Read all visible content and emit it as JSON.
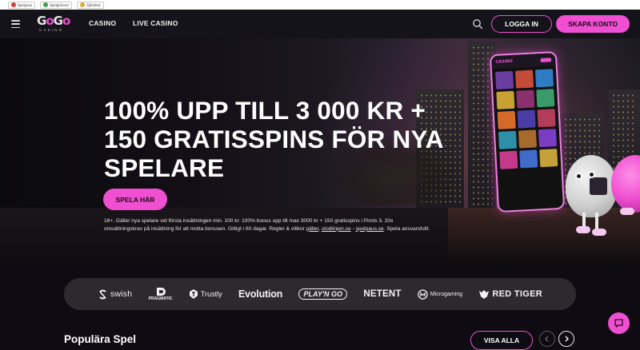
{
  "regulatory": {
    "items": [
      {
        "label": "Spelpaus",
        "color": "#d93a3a"
      },
      {
        "label": "Spelgränser",
        "color": "#3aa34b"
      },
      {
        "label": "Självtest",
        "color": "#e0a93a"
      }
    ]
  },
  "header": {
    "logo_main": [
      "G",
      "o",
      "G",
      "o"
    ],
    "logo_sub": "CASINO",
    "nav": [
      {
        "label": "CASINO"
      },
      {
        "label": "LIVE CASINO"
      }
    ],
    "login_label": "LOGGA IN",
    "signup_label": "SKAPA KONTO",
    "icons": {
      "menu": "hamburger-icon",
      "search": "search-icon"
    }
  },
  "hero": {
    "title": "100% UPP TILL 3 000 KR + 150 GRATISSPINS FÖR NYA SPELARE",
    "cta_label": "SPELA HÄR",
    "terms_text": "18+. Gäller nya spelare vid första insättningen min. 100 kr. 100% bonus upp till max 3000 kr + 150 gratisspins i Pirots 3. 20x omsättningskrav på insättning för att motta bonusen. Giltigt i 60 dagar. Regler & villkor ",
    "terms_link1": "gäller",
    "terms_sep1": ", ",
    "terms_link2": "stodlinjen.se",
    "terms_sep2": " - ",
    "terms_link3": "spelpaus.se",
    "terms_end": ". Spela ansvarsfullt."
  },
  "providers": [
    {
      "name": "swish",
      "label": "swish"
    },
    {
      "name": "pragmatic",
      "label": "PRAGMATIC"
    },
    {
      "name": "trustly",
      "label": "Trustly"
    },
    {
      "name": "evolution",
      "label": "Evolution"
    },
    {
      "name": "playngo",
      "label": "PLAY'N GO"
    },
    {
      "name": "netent",
      "label": "NETENT"
    },
    {
      "name": "microgaming",
      "label": "Microgaming"
    },
    {
      "name": "redtiger",
      "label": "RED TIGER"
    }
  ],
  "popular": {
    "title": "Populära Spel",
    "view_all_label": "VISA ALLA"
  },
  "colors": {
    "accent": "#ef4fd0",
    "background": "#0e0c12",
    "header_bg": "#15131a",
    "provider_strip": "#2c2a2f"
  }
}
